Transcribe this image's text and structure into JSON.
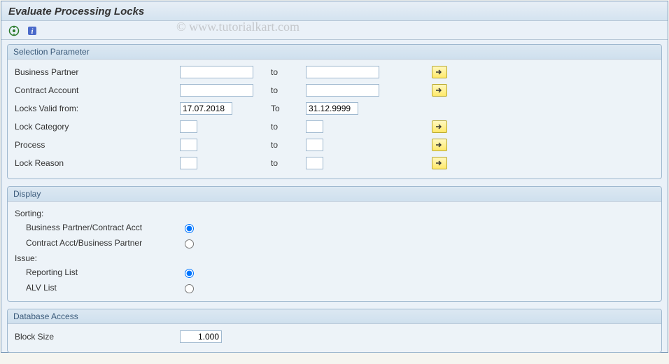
{
  "title": "Evaluate Processing Locks",
  "watermark": "© www.tutorialkart.com",
  "groups": {
    "selection": {
      "header": "Selection Parameter",
      "rows": {
        "bp": {
          "label": "Business Partner",
          "to": "to",
          "from_val": "",
          "to_val": ""
        },
        "ca": {
          "label": "Contract Account",
          "to": "to",
          "from_val": "",
          "to_val": ""
        },
        "lvf": {
          "label": "Locks Valid from:",
          "to": "To",
          "from_val": "17.07.2018",
          "to_val": "31.12.9999"
        },
        "lcat": {
          "label": "Lock Category",
          "to": "to",
          "from_val": "",
          "to_val": ""
        },
        "proc": {
          "label": "Process",
          "to": "to",
          "from_val": "",
          "to_val": ""
        },
        "lrsn": {
          "label": "Lock Reason",
          "to": "to",
          "from_val": "",
          "to_val": ""
        }
      }
    },
    "display": {
      "header": "Display",
      "sorting_label": "Sorting:",
      "sort1": "Business Partner/Contract Acct",
      "sort2": "Contract Acct/Business Partner",
      "issue_label": "Issue:",
      "issue1": "Reporting List",
      "issue2": "ALV List"
    },
    "db": {
      "header": "Database Access",
      "block_size_label": "Block Size",
      "block_size_val": "1.000"
    }
  }
}
